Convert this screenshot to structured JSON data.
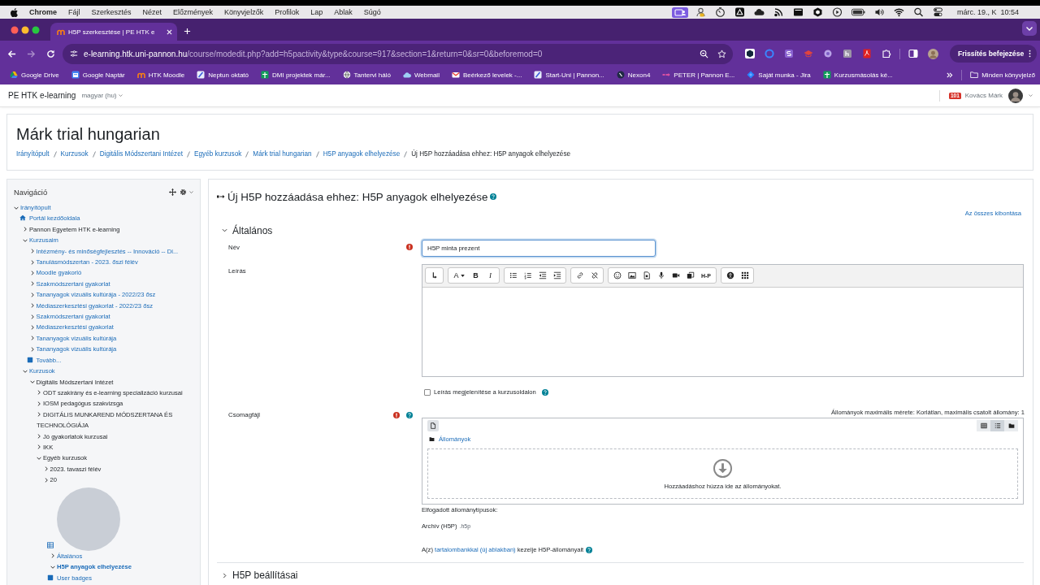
{
  "mac_menu_bar": {
    "app_name": "Chrome",
    "menus": [
      "Fájl",
      "Szerkesztés",
      "Nézet",
      "Előzmények",
      "Könyvjelzők",
      "Profilok",
      "Lap",
      "Ablak",
      "Súgó"
    ],
    "clock": "márc. 19., K  10:54"
  },
  "browser": {
    "tabs": [
      {
        "title": "H5P szerkesztése | PE HTK e",
        "selected": true
      }
    ],
    "nav_buttons": [
      {
        "kind": "back",
        "disabled": false
      },
      {
        "kind": "forward",
        "disabled": true
      },
      {
        "kind": "reload",
        "disabled": false
      }
    ],
    "address": {
      "host": "e-learning.htk.uni-pannon.hu",
      "path": "/course/modedit.php?add=h5pactivity&type&course=917&section=1&return=0&sr=0&beforemod=0"
    },
    "update_button": "Frissítés befejezése",
    "bookmarks": [
      "Google Drive",
      "Google Naptár",
      "HTK Moodle",
      "Neptun oktató",
      "DMI projektek már...",
      "Tantervi háló",
      "Webmail",
      "Beérkező levelek -...",
      "Start-Uni | Pannon...",
      "Nexon4",
      "PETER | Pannon E...",
      "Saját munka - Jira",
      "Kurzusmásolás ké..."
    ],
    "all_bookmarks": "Minden könyvjelző"
  },
  "site_header": {
    "site_name": "PE HTK e-learning",
    "language": "magyar (hu)",
    "badge": "101",
    "user_name": "Kovács Márk"
  },
  "page_header": {
    "title": "Márk trial hungarian",
    "breadcrumb": [
      {
        "label": "Irányítópult",
        "link": true
      },
      {
        "label": "Kurzusok",
        "link": true
      },
      {
        "label": "Digitális Módszertani Intézet",
        "link": true
      },
      {
        "label": "Egyéb kurzusok",
        "link": true
      },
      {
        "label": "Márk trial hungarian",
        "link": true
      },
      {
        "label": "H5P anyagok elhelyezése",
        "link": true
      },
      {
        "label": "Új H5P hozzáadása ehhez: H5P anyagok elhelyezése",
        "link": false
      }
    ]
  },
  "navigation": {
    "title": "Navigáció",
    "tree": [
      {
        "label": "Irányítópult",
        "kind": "branch",
        "link": true,
        "expanded": true,
        "children": [
          {
            "label": "Portál kezdőoldala",
            "kind": "home",
            "link": true
          },
          {
            "label": "Pannon Egyetem HTK e-learning",
            "kind": "branch",
            "link": false,
            "expanded": false
          },
          {
            "label": "Kurzusaim",
            "kind": "branch",
            "link": true,
            "expanded": true,
            "children": [
              {
                "label": "Intézmény- és minőségfejlesztés -- Innováció -- Di...",
                "kind": "branch",
                "link": true,
                "expanded": false
              },
              {
                "label": "Tanulásmódszertan - 2023. őszi félév",
                "kind": "branch",
                "link": true,
                "expanded": false
              },
              {
                "label": "Moodle gyakorló",
                "kind": "branch",
                "link": true,
                "expanded": false
              },
              {
                "label": "Szakmódszertani gyakorlat",
                "kind": "branch",
                "link": true,
                "expanded": false
              },
              {
                "label": "Tananyagok vizuális kultúrája - 2022/23 ősz",
                "kind": "branch",
                "link": true,
                "expanded": false
              },
              {
                "label": "Médiaszerkesztési gyakorlat - 2022/23 ősz",
                "kind": "branch",
                "link": true,
                "expanded": false
              },
              {
                "label": "Szakmódszertani gyakorlat",
                "kind": "branch",
                "link": true,
                "expanded": false
              },
              {
                "label": "Médiaszerkesztési gyakorlat",
                "kind": "branch",
                "link": true,
                "expanded": false
              },
              {
                "label": "Tananyagok vizuális kultúrája",
                "kind": "branch",
                "link": true,
                "expanded": false
              },
              {
                "label": "Tananyagok vizuális kultúrája",
                "kind": "branch",
                "link": true,
                "expanded": false
              },
              {
                "label": "Tovább...",
                "kind": "leaf",
                "link": true
              }
            ]
          },
          {
            "label": "Kurzusok",
            "kind": "branch",
            "link": true,
            "expanded": true,
            "children": [
              {
                "label": "Digitális Módszertani Intézet",
                "kind": "branch",
                "link": false,
                "expanded": true,
                "children": [
                  {
                    "label": "ODT szakirány és e-learning specializáció kurzusai",
                    "kind": "branch",
                    "link": false,
                    "expanded": false
                  },
                  {
                    "label": "IOSM pedagógus szakvizsga",
                    "kind": "branch",
                    "link": false,
                    "expanded": false
                  },
                  {
                    "label": "DIGITÁLIS MUNKAREND MÓDSZERTANA ÉS TECHNOLÓGIÁJA",
                    "kind": "branch",
                    "link": false,
                    "expanded": false
                  },
                  {
                    "label": "Jó gyakorlatok kurzusai",
                    "kind": "branch",
                    "link": false,
                    "expanded": false
                  },
                  {
                    "label": "IKK",
                    "kind": "branch",
                    "link": false,
                    "expanded": false
                  },
                  {
                    "label": "Egyéb kurzusok",
                    "kind": "branch",
                    "link": false,
                    "expanded": true,
                    "children": [
                      {
                        "label": "2023. tavaszi félév",
                        "kind": "branch",
                        "link": false,
                        "expanded": false
                      },
                      {
                        "label": "20",
                        "kind": "branch",
                        "link": false,
                        "expanded": false
                      },
                      {
                        "kind": "covered",
                        "children": [
                          {
                            "kind": "grid"
                          },
                          {
                            "label": "Általános",
                            "kind": "branch",
                            "link": true,
                            "expanded": false,
                            "active": false
                          },
                          {
                            "label": "H5P anyagok elhelyezése",
                            "kind": "branch",
                            "link": true,
                            "expanded": true,
                            "active": true
                          },
                          {
                            "label": "User badges",
                            "kind": "leaf",
                            "link": true,
                            "active": false
                          }
                        ]
                      }
                    ]
                  }
                ]
              }
            ]
          }
        ]
      }
    ]
  },
  "form": {
    "title": "Új H5P hozzáadása ehhez: H5P anyagok elhelyezése",
    "expand_all": "Az összes kibontása",
    "general_section": {
      "title": "Általános",
      "expanded": true,
      "name": {
        "label": "Név",
        "required": true,
        "value": "H5P minta prezent",
        "focused": true
      },
      "description": {
        "label": "Leírás",
        "toolbar": [
          [
            {
              "kind": "icon"
            }
          ],
          [
            {
              "kind": "styles",
              "label": "A"
            },
            {
              "kind": "bold",
              "label": "B"
            },
            {
              "kind": "italic",
              "label": "I"
            }
          ],
          [
            {
              "kind": "icon"
            },
            {
              "kind": "icon"
            },
            {
              "kind": "icon"
            },
            {
              "kind": "icon"
            }
          ],
          [
            {
              "kind": "icon"
            },
            {
              "kind": "icon"
            }
          ],
          [
            {
              "kind": "icon"
            },
            {
              "kind": "icon"
            },
            {
              "kind": "icon"
            },
            {
              "kind": "icon"
            },
            {
              "kind": "icon"
            },
            {
              "kind": "icon"
            },
            {
              "kind": "h5p",
              "label": "H-P"
            }
          ],
          [
            {
              "kind": "icon"
            },
            {
              "kind": "icon"
            }
          ]
        ]
      },
      "show_description": {
        "label": "Leírás megjelenítése a kurzusoldalon",
        "checked": false
      },
      "package_file": {
        "label": "Csomagfájl",
        "required": true,
        "limits": "Állományok maximális mérete: Korlátlan, maximális csatolt állomány: 1",
        "view_modes": [
          {
            "selected": false
          },
          {
            "selected": true
          },
          {
            "selected": false
          }
        ],
        "folder": "Állományok",
        "drop_hint": "Hozzáadáshoz húzza ide az állományokat.",
        "accepted_label": "Elfogadott állománytípusok:",
        "accepted_types": [
          {
            "name": "Archív (H5P)",
            "extension": ".h5p"
          }
        ],
        "note": {
          "before": "A(z)",
          "link": "tartalombankkal (új ablakban)",
          "after": "kezelje H5P-állományait"
        }
      }
    },
    "settings_section": {
      "title": "H5P beállításai",
      "expanded": false
    }
  }
}
